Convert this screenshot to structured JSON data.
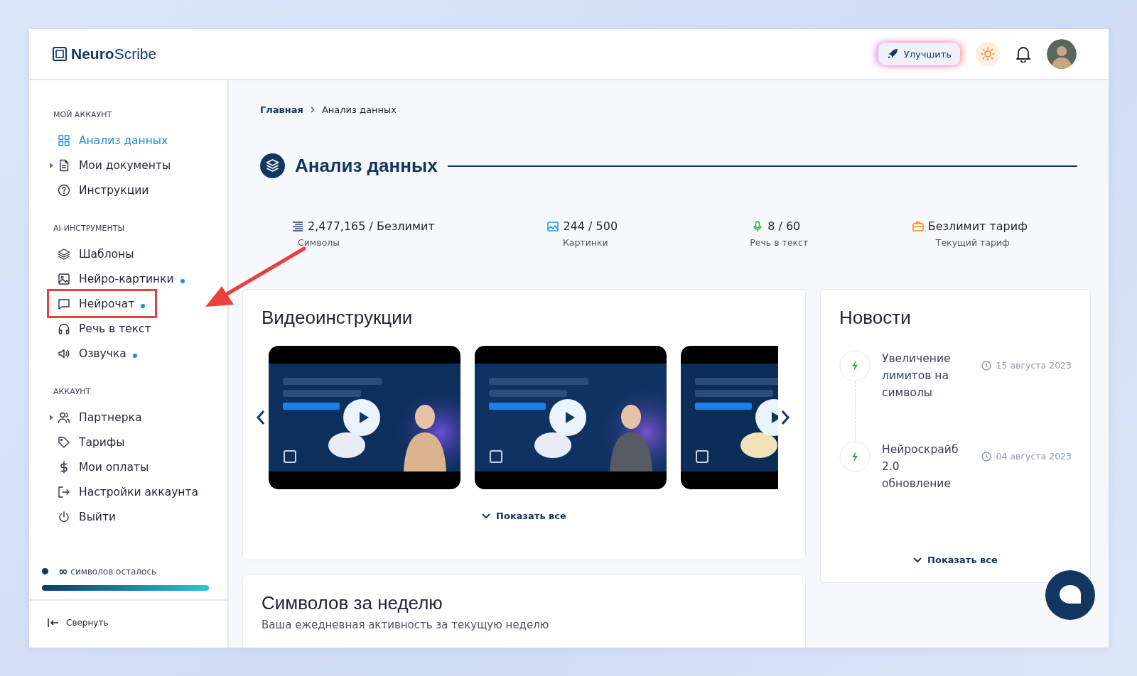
{
  "header": {
    "logo_bold": "Neuro",
    "logo_rest": "Scribe",
    "upgrade_button": "Улучшить"
  },
  "sidebar": {
    "sections": [
      {
        "title": "МОЙ АККАУНТ",
        "items": [
          {
            "label": "Анализ данных",
            "selected": true,
            "expandable": false,
            "dot": false,
            "annotated": false
          },
          {
            "label": "Мои документы",
            "selected": false,
            "expandable": true,
            "dot": false,
            "annotated": false
          },
          {
            "label": "Инструкции",
            "selected": false,
            "expandable": false,
            "dot": false,
            "annotated": false
          }
        ]
      },
      {
        "title": "AI-ИНСТРУМЕНТЫ",
        "items": [
          {
            "label": "Шаблоны",
            "selected": false,
            "expandable": false,
            "dot": false,
            "annotated": false
          },
          {
            "label": "Нейро-картинки",
            "selected": false,
            "expandable": false,
            "dot": true,
            "annotated": false
          },
          {
            "label": "Нейрочат",
            "selected": false,
            "expandable": false,
            "dot": true,
            "annotated": true
          },
          {
            "label": "Речь в текст",
            "selected": false,
            "expandable": false,
            "dot": false,
            "annotated": false
          },
          {
            "label": "Озвучка",
            "selected": false,
            "expandable": false,
            "dot": true,
            "annotated": false
          }
        ]
      },
      {
        "title": "АККАУНТ",
        "items": [
          {
            "label": "Партнерка",
            "selected": false,
            "expandable": true,
            "dot": false,
            "annotated": false
          },
          {
            "label": "Тарифы",
            "selected": false,
            "expandable": false,
            "dot": false,
            "annotated": false
          },
          {
            "label": "Мои оплаты",
            "selected": false,
            "expandable": false,
            "dot": false,
            "annotated": false
          },
          {
            "label": "Настройки аккаунта",
            "selected": false,
            "expandable": false,
            "dot": false,
            "annotated": false
          },
          {
            "label": "Выйти",
            "selected": false,
            "expandable": false,
            "dot": false,
            "annotated": false
          }
        ]
      }
    ],
    "credits": {
      "symbol": "∞",
      "label": "символов осталось",
      "level": 1
    },
    "collapse": "Свернуть"
  },
  "breadcrumb": [
    "Главная",
    "Анализ данных"
  ],
  "page_title": "Анализ данных",
  "stats": [
    {
      "value": "2,477,165 / Безлимит",
      "label": "Символы"
    },
    {
      "value": "244 / 500",
      "label": "Картинки"
    },
    {
      "value": "8 / 60",
      "label": "Речь в текст"
    },
    {
      "value": "Безлимит тариф",
      "label": "Текущий тариф"
    }
  ],
  "videos": {
    "title": "Видеоинструкции",
    "show_all": "Показать все"
  },
  "news": {
    "title": "Новости",
    "items": [
      {
        "text": "Увеличение лимитов на символы",
        "date": "15 августа 2023"
      },
      {
        "text": "Нейроскрайб 2.0 обновление",
        "date": "04 августа 2023"
      }
    ],
    "show_all": "Показать все"
  },
  "weekly": {
    "title": "Символов за неделю",
    "subtitle": "Ваша ежедневная активность за текущую неделю"
  }
}
